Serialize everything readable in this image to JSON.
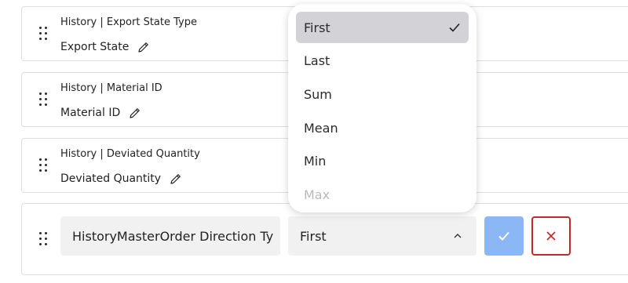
{
  "rows": [
    {
      "source_label": "History | Export State Type",
      "name": "Export State"
    },
    {
      "source_label": "History | Material ID",
      "name": "Material ID"
    },
    {
      "source_label": "History | Deviated Quantity",
      "name": "Deviated Quantity"
    }
  ],
  "editor": {
    "name_value": "HistoryMasterOrder Direction Ty",
    "aggregation_value": "First"
  },
  "dropdown": {
    "options": [
      {
        "label": "First",
        "selected": true
      },
      {
        "label": "Last"
      },
      {
        "label": "Sum"
      },
      {
        "label": "Mean"
      },
      {
        "label": "Min"
      },
      {
        "label": "Max"
      }
    ]
  },
  "colors": {
    "confirm_bg": "#8bb7f5",
    "cancel_border": "#c62828",
    "selected_option_bg": "#d3d3d7"
  }
}
